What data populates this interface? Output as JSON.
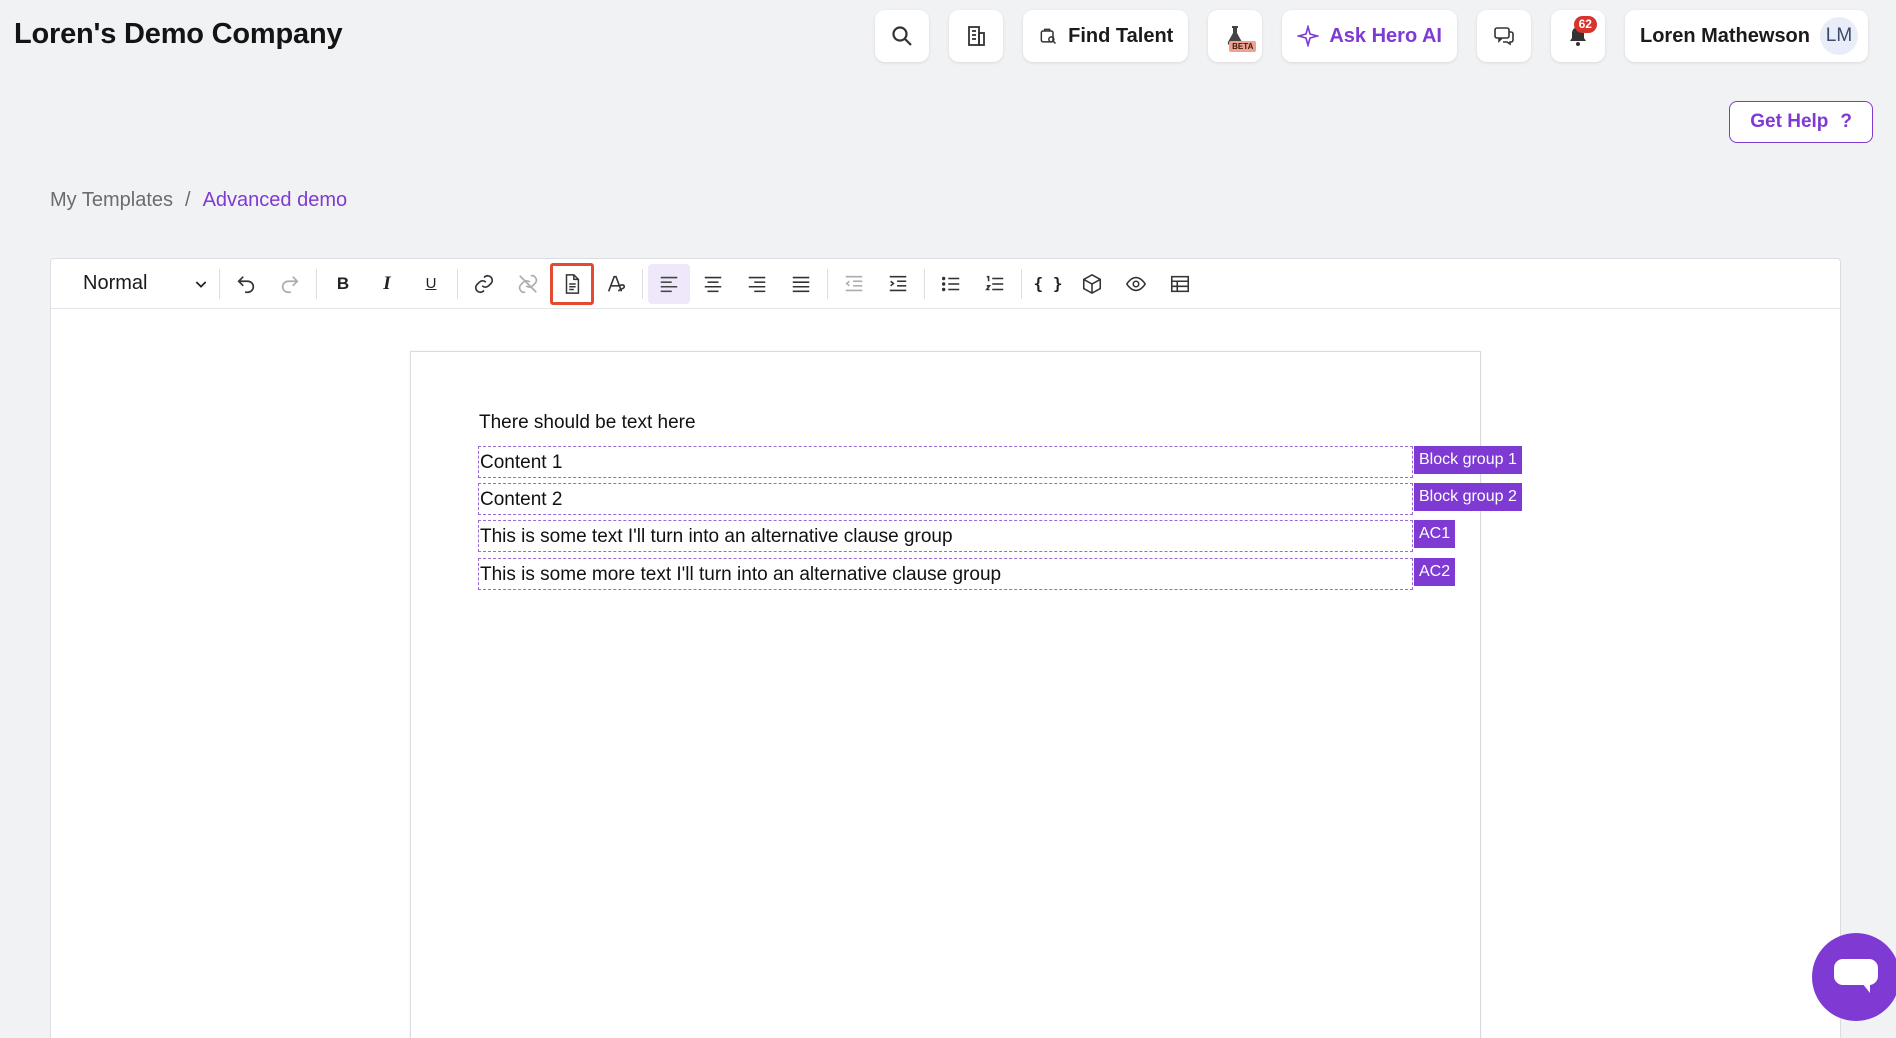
{
  "header": {
    "company": "Loren's Demo Company",
    "find_talent": "Find Talent",
    "beta_tag": "BETA",
    "ask_ai": "Ask Hero AI",
    "notification_count": "62",
    "user_name": "Loren Mathewson",
    "user_initials": "LM"
  },
  "help": {
    "label": "Get Help",
    "icon": "?"
  },
  "breadcrumb": {
    "parent": "My Templates",
    "separator": "/",
    "current": "Advanced demo"
  },
  "toolbar": {
    "style_value": "Normal",
    "buttons": {
      "bold": "B",
      "italic": "I",
      "underline": "U",
      "variables": "{ }"
    }
  },
  "document": {
    "plain_text": "There should be text here",
    "blocks": [
      {
        "text": "Content 1",
        "tag": "Block group 1"
      },
      {
        "text": "Content 2",
        "tag": "Block group 2"
      },
      {
        "text": "This is some text I'll turn into an alternative clause group",
        "tag": "AC1"
      },
      {
        "text": "This is some more text I'll turn into an alternative clause group",
        "tag": "AC2"
      }
    ]
  },
  "colors": {
    "accent": "#7e3ad3",
    "badge": "#d8342c",
    "highlight": "#e34a32"
  }
}
